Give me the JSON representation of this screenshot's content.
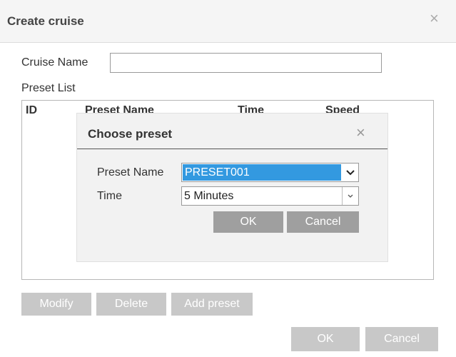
{
  "dialog": {
    "title": "Create cruise",
    "close_symbol": "×",
    "cruise_name_label": "Cruise Name",
    "cruise_name_value": "",
    "preset_list_label": "Preset List",
    "columns": [
      "ID",
      "Preset Name",
      "Time",
      "Speed"
    ],
    "buttons": {
      "modify": "Modify",
      "delete": "Delete",
      "add_preset": "Add preset",
      "ok": "OK",
      "cancel": "Cancel"
    }
  },
  "choose_preset": {
    "title": "Choose preset",
    "close_symbol": "×",
    "preset_name_label": "Preset Name",
    "preset_name_value": "PRESET001",
    "time_label": "Time",
    "time_value": "5 Minutes",
    "ok_label": "OK",
    "cancel_label": "Cancel"
  },
  "icons": {
    "close": "close-icon",
    "dropdown": "chevron-down-icon"
  },
  "colors": {
    "selection": "#3399e0",
    "disabled_button": "#c8c8c8",
    "dialog_button": "#9f9f9f"
  }
}
